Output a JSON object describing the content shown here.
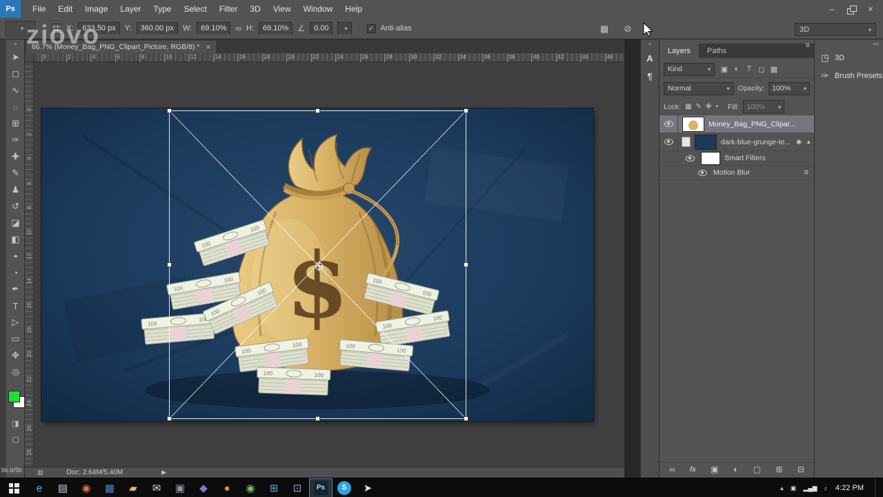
{
  "app": {
    "logo_text": "Ps",
    "window_controls": {
      "minimize": "–",
      "close": "×"
    }
  },
  "menu_bar": {
    "items": [
      "File",
      "Edit",
      "Image",
      "Layer",
      "Type",
      "Select",
      "Filter",
      "3D",
      "View",
      "Window",
      "Help"
    ]
  },
  "options_bar": {
    "x_label": "X:",
    "x_value": "633.50 px",
    "y_label": "Y:",
    "y_value": "360.00 px",
    "w_label": "W:",
    "w_value": "69.10%",
    "h_label": "H:",
    "h_value": "69.10%",
    "angle_value": "0.00",
    "anti_alias_label": "Anti-alias",
    "workspace_label": "3D"
  },
  "watermarks": {
    "large": "ziovo",
    "small": "bb.b/9b"
  },
  "document": {
    "tab_title": "66.7% (Money_Bag_PNG_Clipart_Picture, RGB/8) *",
    "close_glyph": "×",
    "status_doc": "Doc: 2.64M/5.40M"
  },
  "rulers": {
    "top": [
      "0",
      "2",
      "4",
      "6",
      "8",
      "10",
      "12",
      "14",
      "16",
      "18",
      "20",
      "22",
      "24",
      "26",
      "28",
      "30",
      "32",
      "34",
      "36",
      "38",
      "40",
      "42",
      "44",
      "46"
    ],
    "left": [
      "0",
      "2",
      "4",
      "6",
      "8",
      "10",
      "12",
      "14",
      "16",
      "18",
      "20",
      "22",
      "24",
      "26",
      "28"
    ]
  },
  "tools": [
    {
      "name": "move-tool",
      "glyph": "➤"
    },
    {
      "name": "marquee-tool",
      "glyph": "◻"
    },
    {
      "name": "lasso-tool",
      "glyph": "∿"
    },
    {
      "name": "quick-selection-tool",
      "glyph": "◌"
    },
    {
      "name": "crop-tool",
      "glyph": "⊞"
    },
    {
      "name": "eyedropper-tool",
      "glyph": "✑"
    },
    {
      "name": "healing-brush-tool",
      "glyph": "✚"
    },
    {
      "name": "brush-tool",
      "glyph": "✎"
    },
    {
      "name": "clone-stamp-tool",
      "glyph": "♟"
    },
    {
      "name": "history-brush-tool",
      "glyph": "↺"
    },
    {
      "name": "eraser-tool",
      "glyph": "◪"
    },
    {
      "name": "gradient-tool",
      "glyph": "◧"
    },
    {
      "name": "blur-tool",
      "glyph": "◓"
    },
    {
      "name": "dodge-tool",
      "glyph": "◔"
    },
    {
      "name": "pen-tool",
      "glyph": "✒"
    },
    {
      "name": "type-tool",
      "glyph": "T"
    },
    {
      "name": "path-selection-tool",
      "glyph": "▷"
    },
    {
      "name": "shape-tool",
      "glyph": "▭"
    },
    {
      "name": "hand-tool",
      "glyph": "✥"
    },
    {
      "name": "zoom-tool",
      "glyph": "◎"
    }
  ],
  "swatches": {
    "foreground": "#17e32b",
    "background": "#ffffff"
  },
  "right_strip": [
    {
      "name": "character-panel-icon",
      "glyph": "A"
    },
    {
      "name": "paragraph-panel-icon",
      "glyph": "¶"
    }
  ],
  "layers_panel": {
    "tab_layers": "Layers",
    "tab_paths": "Paths",
    "filter_label": "Kind",
    "filter_icons": [
      {
        "name": "filter-pixel-layers-icon",
        "glyph": "▣"
      },
      {
        "name": "filter-adjustment-layers-icon",
        "glyph": "◐"
      },
      {
        "name": "filter-type-layers-icon",
        "glyph": "T"
      },
      {
        "name": "filter-shape-layers-icon",
        "glyph": "◻"
      },
      {
        "name": "filter-smart-objects-icon",
        "glyph": "▦"
      }
    ],
    "blend_mode": "Normal",
    "opacity_label": "Opacity:",
    "opacity_value": "100%",
    "lock_label": "Lock:",
    "lock_icons": [
      {
        "name": "lock-transparency-icon",
        "glyph": "▦"
      },
      {
        "name": "lock-pixels-icon",
        "glyph": "✎"
      },
      {
        "name": "lock-position-icon",
        "glyph": "✥"
      },
      {
        "name": "lock-all-icon",
        "glyph": "▪"
      }
    ],
    "fill_label": "Fill:",
    "fill_value": "100%",
    "rows": {
      "layer1_name": "Money_Bag_PNG_Clipar...",
      "layer2_name": "dark-blue-grunge-te...",
      "smart_filters_label": "Smart Filters",
      "motion_blur_label": "Motion Blur"
    },
    "bottom_icons": [
      {
        "name": "link-layers-icon",
        "glyph": "∞"
      },
      {
        "name": "layer-style-icon",
        "glyph": "fx"
      },
      {
        "name": "add-layer-mask-icon",
        "glyph": "▣"
      },
      {
        "name": "adjustment-layer-icon",
        "glyph": "◐"
      },
      {
        "name": "new-group-icon",
        "glyph": "▢"
      },
      {
        "name": "new-layer-icon",
        "glyph": "⊞"
      },
      {
        "name": "delete-layer-icon",
        "glyph": "⊟"
      }
    ]
  },
  "far_panel": [
    {
      "name": "panel-3d",
      "glyph": "◳",
      "label": "3D"
    },
    {
      "name": "panel-brush-presets",
      "glyph": "✑",
      "label": "Brush Presets"
    }
  ],
  "artwork": {
    "dollar_sign": "$",
    "bill_denomination": "100"
  },
  "taskbar": {
    "items": [
      {
        "name": "taskbar-ie",
        "glyph": "e",
        "color": "#5fb2f2"
      },
      {
        "name": "taskbar-explorer",
        "glyph": "▤",
        "color": "#c9d2da"
      },
      {
        "name": "taskbar-media-player",
        "glyph": "◉",
        "color": "#e0733f"
      },
      {
        "name": "taskbar-app-blue",
        "glyph": "▦",
        "color": "#4f7fd0"
      },
      {
        "name": "taskbar-folder",
        "glyph": "▰",
        "color": "#e9b84e"
      },
      {
        "name": "taskbar-mail",
        "glyph": "✉",
        "color": "#d2dae2"
      },
      {
        "name": "taskbar-app-gray",
        "glyph": "▣",
        "color": "#8e9aa8"
      },
      {
        "name": "taskbar-app-violet",
        "glyph": "◆",
        "color": "#8d72c4"
      },
      {
        "name": "taskbar-app-orange",
        "glyph": "●",
        "color": "#ea8a3c"
      },
      {
        "name": "taskbar-chrome",
        "glyph": "◉",
        "color": "#74c163"
      },
      {
        "name": "taskbar-app-window",
        "glyph": "⊞",
        "color": "#5ea4e6"
      },
      {
        "name": "taskbar-monitor",
        "glyph": "⊡",
        "color": "#84aede"
      },
      {
        "name": "taskbar-photoshop",
        "glyph": "Ps",
        "color": "#a8dcf5",
        "bg": "#16222e",
        "active": true
      },
      {
        "name": "taskbar-skype",
        "glyph": "S",
        "color": "#ffffff",
        "bg": "#2aa9e0",
        "round": true
      },
      {
        "name": "taskbar-pointer",
        "glyph": "➤",
        "color": "#e4e4e4"
      }
    ],
    "tray": [
      {
        "name": "tray-expand-icon",
        "glyph": "▴"
      },
      {
        "name": "tray-status-icon",
        "glyph": "▣"
      },
      {
        "name": "tray-network-icon",
        "glyph": "▂▄▆"
      },
      {
        "name": "tray-volume-icon",
        "glyph": "♪"
      }
    ],
    "time": "4:22 PM"
  }
}
